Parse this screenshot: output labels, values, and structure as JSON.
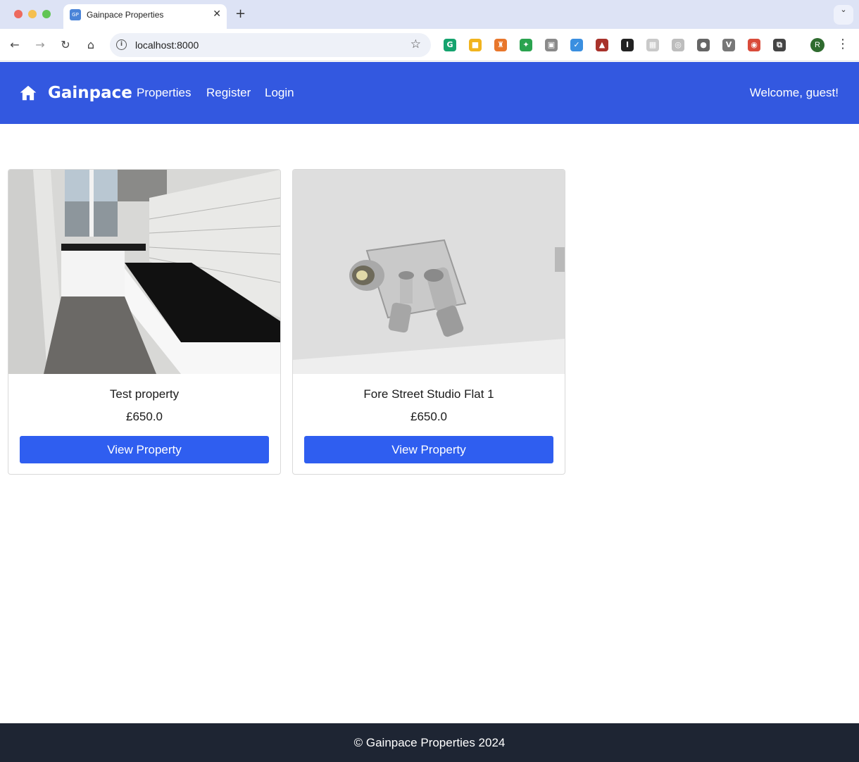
{
  "browser": {
    "tab_title": "Gainpace Properties",
    "tab_favicon": "GP",
    "tab_close": "✕",
    "new_tab": "+",
    "tab_search": "⌄",
    "url": "localhost:8000",
    "nav": {
      "back": "←",
      "forward": "→",
      "reload": "↻",
      "home": "⌂"
    },
    "info": "i",
    "star": "☆",
    "profile_initial": "R",
    "menu": "⋮",
    "extensions": [
      {
        "name": "grammarly-icon",
        "glyph": "G",
        "color": "#15a36e"
      },
      {
        "name": "notes-extension-icon",
        "glyph": "■",
        "color": "#f1b41e"
      },
      {
        "name": "chess-piece-extension-icon",
        "glyph": "♜",
        "color": "#e8772c"
      },
      {
        "name": "bird-extension-icon",
        "glyph": "✦",
        "color": "#2aa34f"
      },
      {
        "name": "portrait-extension-icon",
        "glyph": "▣",
        "color": "#8a8a8a"
      },
      {
        "name": "check-extension-icon",
        "glyph": "✓",
        "color": "#3a8fe0"
      },
      {
        "name": "chart-extension-icon",
        "glyph": "▲",
        "color": "#a8322b"
      },
      {
        "name": "serif-i-extension-icon",
        "glyph": "I",
        "color": "#222222"
      },
      {
        "name": "grid-extension-icon",
        "glyph": "▦",
        "color": "#c9c9c9"
      },
      {
        "name": "target-extension-icon",
        "glyph": "◎",
        "color": "#bdbdbd"
      },
      {
        "name": "apple-extension-icon",
        "glyph": "●",
        "color": "#666666"
      },
      {
        "name": "v-extension-icon",
        "glyph": "V",
        "color": "#777777"
      },
      {
        "name": "color-wheel-extension-icon",
        "glyph": "◉",
        "color": "#d94b3a"
      },
      {
        "name": "puzzle-icon",
        "glyph": "⧉",
        "color": "#444444"
      }
    ]
  },
  "navbar": {
    "brand": "Gainpace",
    "links": [
      "Properties",
      "Register",
      "Login"
    ],
    "welcome": "Welcome, guest!"
  },
  "properties": [
    {
      "title": "Test property",
      "price": "£650.0",
      "button": "View Property",
      "image": "kitchen"
    },
    {
      "title": "Fore Street Studio Flat 1",
      "price": "£650.0",
      "button": "View Property",
      "image": "ceiling-spotlights"
    }
  ],
  "footer": {
    "text": "© Gainpace Properties 2024"
  },
  "colors": {
    "navbar": "#3358e0",
    "button": "#2f5ef0",
    "footer": "#1e2533"
  }
}
